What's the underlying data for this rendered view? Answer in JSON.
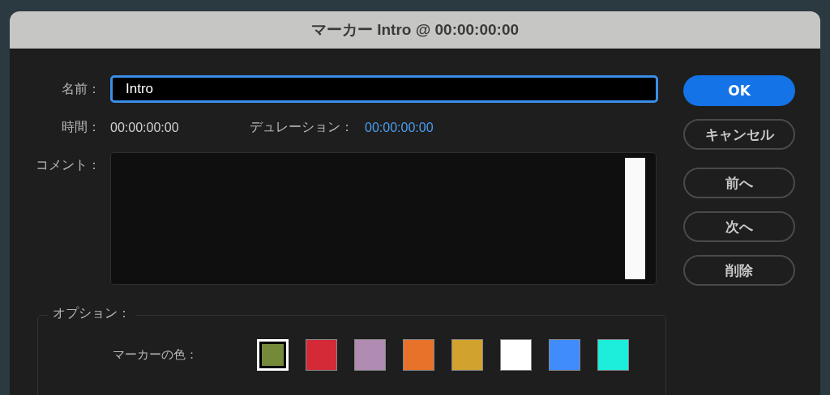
{
  "window": {
    "title": "マーカー Intro @ 00:00:00:00"
  },
  "name": {
    "label": "名前：",
    "value": "Intro"
  },
  "time": {
    "label": "時間：",
    "value": "00:00:00:00"
  },
  "duration": {
    "label": "デュレーション：",
    "value": "00:00:00:00"
  },
  "comment": {
    "label": "コメント："
  },
  "buttons": [
    {
      "label": "OK",
      "kind": "primary"
    },
    {
      "label": "キャンセル",
      "kind": "secondary"
    },
    {
      "label": "前へ",
      "kind": "secondary"
    },
    {
      "label": "次へ",
      "kind": "secondary"
    },
    {
      "label": "削除",
      "kind": "secondary"
    }
  ],
  "options": {
    "legend": "オプション：",
    "marker_color": {
      "label": "マーカーの色：",
      "swatches": [
        {
          "color": "#748a3a",
          "selected": true
        },
        {
          "color": "#d42a38",
          "selected": false
        },
        {
          "color": "#b08cb2",
          "selected": false
        },
        {
          "color": "#e8722a",
          "selected": false
        },
        {
          "color": "#d2a22e",
          "selected": false
        },
        {
          "color": "#ffffff",
          "selected": false
        },
        {
          "color": "#408cfc",
          "selected": false
        },
        {
          "color": "#1ceedb",
          "selected": false
        }
      ]
    }
  }
}
